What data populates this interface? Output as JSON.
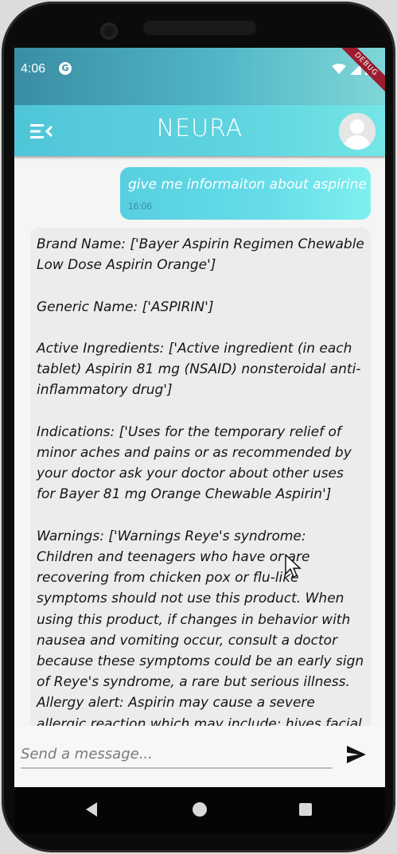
{
  "status_bar": {
    "time": "4:06",
    "notification_icon": "g-circle-icon",
    "debug_banner": "DEBUG",
    "icons": [
      "wifi-icon",
      "signal-icon",
      "battery-icon"
    ]
  },
  "app_bar": {
    "title": "NEURA",
    "menu_icon": "menu-open-icon",
    "avatar_icon": "person-icon"
  },
  "conversation": {
    "user_message": {
      "text": "give me informaiton about aspirine",
      "time": "16:06"
    },
    "bot_message": {
      "text": "Brand Name: ['Bayer Aspirin Regimen Chewable Low Dose Aspirin Orange']\n\nGeneric Name: ['ASPIRIN']\n\nActive Ingredients: ['Active ingredient (in each tablet) Aspirin 81 mg (NSAID) nonsteroidal anti-inflammatory drug']\n\nIndications: ['Uses for the temporary relief of minor aches and pains or as recommended by your doctor ask your doctor about other uses for Bayer 81 mg Orange Chewable Aspirin']\n\nWarnings: ['Warnings Reye's syndrome: Children and teenagers who have or are recovering from chicken pox or flu-like symptoms should not use this product. When using this product, if changes in behavior with nausea and vomiting occur, consult a doctor because these symptoms could be an early sign of Reye's syndrome, a rare but serious illness. Allergy alert: Aspirin may cause a severe allergic reaction which may include: hives facial swelling asthma (wheezing) shock"
    }
  },
  "composer": {
    "placeholder": "Send a message...",
    "value": "",
    "send_icon": "send-icon"
  },
  "nav_bar": {
    "icons": [
      "back-icon",
      "home-icon",
      "recents-icon"
    ]
  },
  "colors": {
    "status_bar_start": "#3a8da3",
    "app_bar_accent": "#5fd4e0",
    "user_bubble": "#66dde8",
    "bot_bubble": "#ececec",
    "debug_ribbon": "#9b1c2e"
  }
}
